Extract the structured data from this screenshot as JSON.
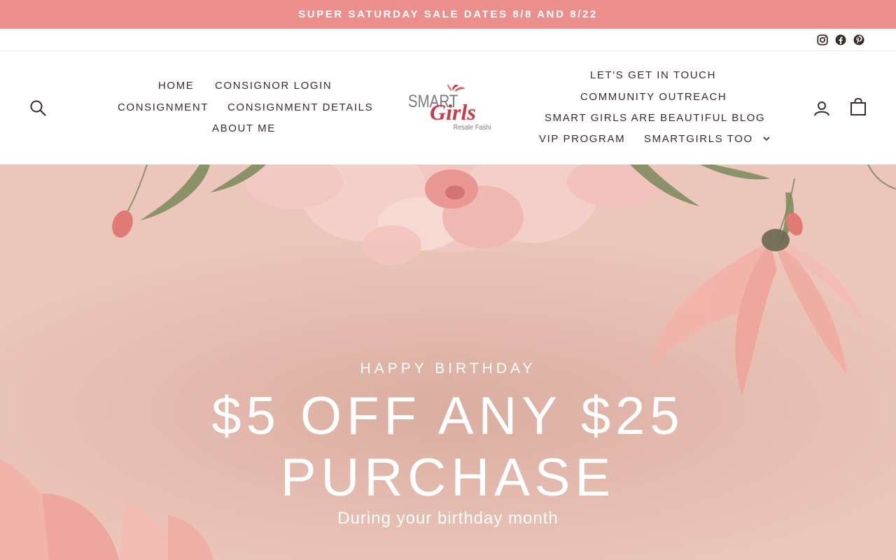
{
  "announcement": {
    "text": "SUPER SATURDAY SALE DATES 8/8 AND 8/22"
  },
  "social": {
    "icons": [
      "instagram-icon",
      "facebook-icon",
      "pinterest-icon"
    ]
  },
  "logo": {
    "line1": "SMART",
    "line2": "Girls",
    "line3": "Resale Fashion"
  },
  "nav_left": {
    "home": "HOME",
    "consignor_login": "CONSIGNOR LOGIN",
    "consignment": "CONSIGNMENT",
    "consignment_details": "CONSIGNMENT DETAILS",
    "about_me": "ABOUT ME"
  },
  "nav_right": {
    "get_in_touch": "LET'S GET IN TOUCH",
    "community_outreach": "COMMUNITY OUTREACH",
    "blog": "SMART GIRLS ARE BEAUTIFUL BLOG",
    "vip_program": "VIP PROGRAM",
    "smartgirls_too": "SMARTGIRLS TOO"
  },
  "header_icons": {
    "search": "search-icon",
    "account": "user-icon",
    "cart": "bag-icon"
  },
  "hero": {
    "kicker": "HAPPY BIRTHDAY",
    "headline_line1": "$5 OFF ANY $25",
    "headline_line2": "PURCHASE",
    "subtext": "During your birthday month"
  },
  "colors": {
    "announcement_bg": "#ec8f8c",
    "logo_red": "#c93a4b",
    "logo_grey": "#7b7b7b",
    "nav_text": "#3d2a2a"
  }
}
